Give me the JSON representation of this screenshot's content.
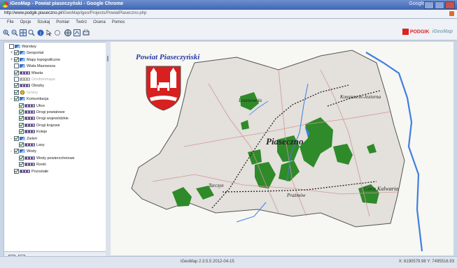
{
  "window": {
    "title": "iGeoMap - Powiat piaseczyński - Google Chrome",
    "user": "Google"
  },
  "address": {
    "host": "http://www.podgik.piaseczno.pl",
    "path": "/iGeoMap/igeo/Projects/PowiatPiaseczno.php"
  },
  "menu": [
    "File",
    "Opcje",
    "Szukaj",
    "Pomiar",
    "Twórz",
    "Ocena",
    "Pomoc"
  ],
  "toolbar": {
    "tools": [
      "zoom-in-icon",
      "zoom-out-icon",
      "pan-icon",
      "zoom-box-icon",
      "identify-icon",
      "select-icon",
      "info-icon",
      "globe-icon",
      "measure-icon",
      "print-icon"
    ]
  },
  "logos": {
    "podgik": "PODGIK",
    "igeomap": "iGeoMap"
  },
  "layers": [
    {
      "indent": 0,
      "tw": "",
      "icon": "grp",
      "label": "Warstwy",
      "on": false,
      "dim": false
    },
    {
      "indent": 1,
      "tw": "+",
      "icon": "grp",
      "label": "Geoportal",
      "on": true,
      "dim": false
    },
    {
      "indent": 1,
      "tw": "+",
      "icon": "grp",
      "label": "Mapy topograficzne",
      "on": true,
      "dim": false
    },
    {
      "indent": 1,
      "tw": "",
      "icon": "grp",
      "label": "Wisła Mazowsza",
      "on": false,
      "dim": false
    },
    {
      "indent": 1,
      "tw": "",
      "icon": "line",
      "label": "Miasta",
      "on": true,
      "dim": false
    },
    {
      "indent": 1,
      "tw": "",
      "icon": "line gray",
      "label": "Ortofotomapa",
      "on": false,
      "dim": true
    },
    {
      "indent": 1,
      "tw": "",
      "icon": "line",
      "label": "Obręby",
      "on": true,
      "dim": false
    },
    {
      "indent": 1,
      "tw": "",
      "icon": "gold",
      "label": "Gminy",
      "on": true,
      "dim": true
    },
    {
      "indent": 1,
      "tw": "-",
      "icon": "grp",
      "label": "Komunikacja",
      "on": true,
      "dim": false
    },
    {
      "indent": 2,
      "tw": "",
      "icon": "line",
      "label": "Ulice",
      "on": true,
      "dim": false
    },
    {
      "indent": 2,
      "tw": "",
      "icon": "line",
      "label": "Drogi powiatowe",
      "on": true,
      "dim": false
    },
    {
      "indent": 2,
      "tw": "",
      "icon": "line",
      "label": "Drogi wojewódzkie",
      "on": true,
      "dim": false
    },
    {
      "indent": 2,
      "tw": "",
      "icon": "line",
      "label": "Drogi krajowe",
      "on": true,
      "dim": false
    },
    {
      "indent": 2,
      "tw": "",
      "icon": "line",
      "label": "Koleje",
      "on": true,
      "dim": false
    },
    {
      "indent": 1,
      "tw": "-",
      "icon": "grp",
      "label": "Zieleń",
      "on": true,
      "dim": false
    },
    {
      "indent": 2,
      "tw": "",
      "icon": "line",
      "label": "Lasy",
      "on": true,
      "dim": false
    },
    {
      "indent": 1,
      "tw": "-",
      "icon": "grp",
      "label": "Wody",
      "on": true,
      "dim": false
    },
    {
      "indent": 2,
      "tw": "",
      "icon": "line",
      "label": "Wody powierzchniowe",
      "on": true,
      "dim": false
    },
    {
      "indent": 2,
      "tw": "",
      "icon": "line",
      "label": "Rzeki",
      "on": true,
      "dim": false
    },
    {
      "indent": 1,
      "tw": "",
      "icon": "line",
      "label": "Pozostałe",
      "on": true,
      "dim": false
    }
  ],
  "map": {
    "title": "Powiat Piaseczyński",
    "towns": [
      "Lesznowola",
      "Konstancin-Jeziorna",
      "Piaseczno",
      "Tarczyn",
      "Prażmów",
      "Góra Kalwaria"
    ],
    "colors": {
      "forest": "#2f8a2a",
      "water": "#3e7fe0",
      "border": "#444444"
    }
  },
  "status": {
    "version": "iGeoMap 2.3.5.5 2012-04-15",
    "coords": "X: 6190579.98 Y: 7495516.93"
  }
}
